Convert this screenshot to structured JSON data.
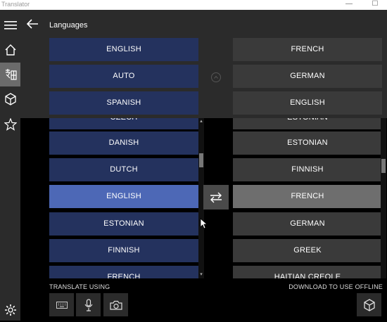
{
  "app": {
    "title": "Translator",
    "window_controls": {
      "minimize": "—",
      "maximize": "☐"
    }
  },
  "header": {
    "title": "Languages"
  },
  "pinned": {
    "source": [
      "ENGLISH",
      "AUTO",
      "SPANISH"
    ],
    "target": [
      "FRENCH",
      "GERMAN",
      "ENGLISH"
    ]
  },
  "lists": {
    "source": [
      "CZECH",
      "DANISH",
      "DUTCH",
      "ENGLISH",
      "ESTONIAN",
      "FINNISH",
      "FRENCH"
    ],
    "source_selected": "ENGLISH",
    "target": [
      "ESTONIAN",
      "ESTONIAN",
      "FINNISH",
      "FRENCH",
      "GERMAN",
      "GREEK",
      "HAITIAN CREOLE"
    ],
    "target_selected": "FRENCH"
  },
  "bottom": {
    "translate_using": "TRANSLATE USING",
    "download_offline": "DOWNLOAD TO USE OFFLINE"
  },
  "icons": {
    "menu": "hamburger-icon",
    "home": "home-icon",
    "phrasebook": "translate-characters-icon",
    "offline": "cube-icon",
    "favorites": "star-icon",
    "settings": "gear-icon",
    "back": "back-arrow-icon",
    "swap": "swap-arrows-icon",
    "keyboard": "keyboard-icon",
    "microphone": "microphone-icon",
    "camera": "camera-icon",
    "download": "cube-icon"
  },
  "colors": {
    "source_item": "#24325e",
    "source_selected": "#4d68b6",
    "target_item": "#3a3a3a",
    "target_selected": "#6e6e6e",
    "chrome": "#2b2b2b"
  }
}
